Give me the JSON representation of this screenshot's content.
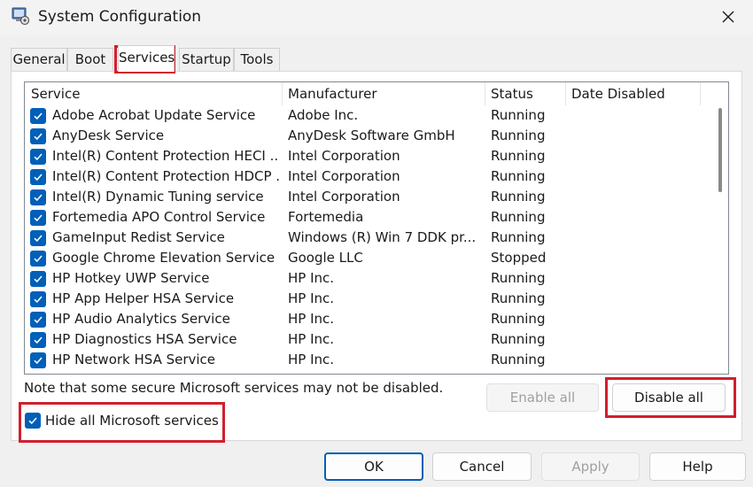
{
  "window": {
    "title": "System Configuration",
    "app_icon": "msconfig-icon",
    "close_icon": "close-icon"
  },
  "tabs": [
    {
      "label": "General"
    },
    {
      "label": "Boot"
    },
    {
      "label": "Services",
      "active": true
    },
    {
      "label": "Startup"
    },
    {
      "label": "Tools"
    }
  ],
  "columns": {
    "service": "Service",
    "manufacturer": "Manufacturer",
    "status": "Status",
    "date_disabled": "Date Disabled"
  },
  "services": [
    {
      "name": "Adobe Acrobat Update Service",
      "manufacturer": "Adobe Inc.",
      "status": "Running",
      "date_disabled": "",
      "checked": true
    },
    {
      "name": "AnyDesk Service",
      "manufacturer": "AnyDesk Software GmbH",
      "status": "Running",
      "date_disabled": "",
      "checked": true
    },
    {
      "name": "Intel(R) Content Protection HECI ...",
      "manufacturer": "Intel Corporation",
      "status": "Running",
      "date_disabled": "",
      "checked": true
    },
    {
      "name": "Intel(R) Content Protection HDCP ...",
      "manufacturer": "Intel Corporation",
      "status": "Running",
      "date_disabled": "",
      "checked": true
    },
    {
      "name": "Intel(R) Dynamic Tuning service",
      "manufacturer": "Intel Corporation",
      "status": "Running",
      "date_disabled": "",
      "checked": true
    },
    {
      "name": "Fortemedia APO Control Service",
      "manufacturer": "Fortemedia",
      "status": "Running",
      "date_disabled": "",
      "checked": true
    },
    {
      "name": "GameInput Redist Service",
      "manufacturer": "Windows (R) Win 7 DDK pr...",
      "status": "Running",
      "date_disabled": "",
      "checked": true
    },
    {
      "name": "Google Chrome Elevation Service ...",
      "manufacturer": "Google LLC",
      "status": "Stopped",
      "date_disabled": "",
      "checked": true
    },
    {
      "name": "HP Hotkey UWP Service",
      "manufacturer": "HP Inc.",
      "status": "Running",
      "date_disabled": "",
      "checked": true
    },
    {
      "name": "HP App Helper HSA Service",
      "manufacturer": "HP Inc.",
      "status": "Running",
      "date_disabled": "",
      "checked": true
    },
    {
      "name": "HP Audio Analytics Service",
      "manufacturer": "HP Inc.",
      "status": "Running",
      "date_disabled": "",
      "checked": true
    },
    {
      "name": "HP Diagnostics HSA Service",
      "manufacturer": "HP Inc.",
      "status": "Running",
      "date_disabled": "",
      "checked": true
    },
    {
      "name": "HP Network HSA Service",
      "manufacturer": "HP Inc.",
      "status": "Running",
      "date_disabled": "",
      "checked": true
    }
  ],
  "note": "Note that some secure Microsoft services may not be disabled.",
  "buttons": {
    "enable_all": "Enable all",
    "disable_all": "Disable all",
    "ok": "OK",
    "cancel": "Cancel",
    "apply": "Apply",
    "help": "Help"
  },
  "hide_ms": {
    "label": "Hide all Microsoft services",
    "checked": true
  },
  "colors": {
    "accent": "#005fb8",
    "highlight": "#d11f2e",
    "disabled_text": "#a0a0a0"
  }
}
